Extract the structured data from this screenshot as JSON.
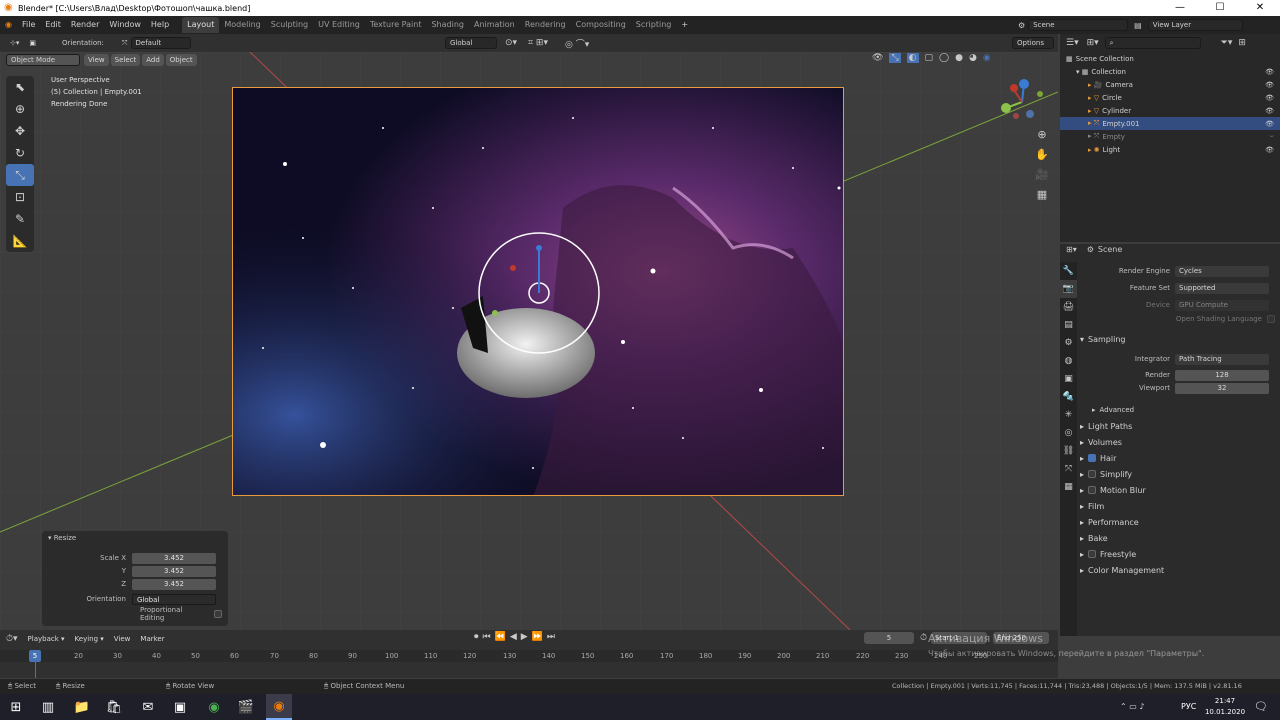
{
  "title_bar": {
    "text": "Blender* [C:\\Users\\Влад\\Desktop\\Фотошоп\\чашка.blend]"
  },
  "menu": [
    "File",
    "Edit",
    "Render",
    "Window",
    "Help"
  ],
  "workspaces": [
    "Layout",
    "Modeling",
    "Sculpting",
    "UV Editing",
    "Texture Paint",
    "Shading",
    "Animation",
    "Rendering",
    "Compositing",
    "Scripting"
  ],
  "scene": {
    "name": "Scene",
    "view_layer": "View Layer"
  },
  "header": {
    "orientation_label": "Orientation:",
    "orientation_value": "Default",
    "transform": "Global",
    "options": "Options"
  },
  "mode_bar": {
    "mode": "Object Mode",
    "view": "View",
    "select": "Select",
    "add": "Add",
    "object": "Object"
  },
  "viewport_info": {
    "line1": "User Perspective",
    "line2": "(5) Collection | Empty.001",
    "line3": "Rendering Done"
  },
  "redo_panel": {
    "title": "Resize",
    "scale_x_label": "Scale X",
    "scale_x": "3.452",
    "y_label": "Y",
    "y": "3.452",
    "z_label": "Z",
    "z": "3.452",
    "orientation_label": "Orientation",
    "orientation": "Global",
    "proportional_label": "Proportional Editing"
  },
  "outliner": {
    "root": "Scene Collection",
    "collection": "Collection",
    "items": [
      "Camera",
      "Circle",
      "Cylinder",
      "Empty.001",
      "Empty",
      "Light"
    ]
  },
  "properties": {
    "context": "Scene",
    "render_engine_label": "Render Engine",
    "render_engine": "Cycles",
    "feature_set_label": "Feature Set",
    "feature_set": "Supported",
    "device_label": "Device",
    "device": "GPU Compute",
    "osl_label": "Open Shading Language",
    "sampling": "Sampling",
    "integrator_label": "Integrator",
    "integrator": "Path Tracing",
    "render_label": "Render",
    "render_samples": "128",
    "viewport_label": "Viewport",
    "viewport_samples": "32",
    "advanced": "Advanced",
    "panels": [
      "Light Paths",
      "Volumes",
      "Hair",
      "Simplify",
      "Motion Blur",
      "Film",
      "Performance",
      "Bake",
      "Freestyle",
      "Color Management"
    ]
  },
  "timeline": {
    "menus": [
      "Playback",
      "Keying",
      "View",
      "Marker"
    ],
    "current_frame": "5",
    "start_label": "Start",
    "start": "1",
    "end_label": "End",
    "end": "250",
    "ruler": [
      "5",
      "20",
      "30",
      "40",
      "50",
      "60",
      "70",
      "80",
      "90",
      "100",
      "110",
      "120",
      "130",
      "140",
      "150",
      "160",
      "170",
      "180",
      "190",
      "200",
      "210",
      "220",
      "230",
      "240",
      "250"
    ]
  },
  "watermark": {
    "line1": "Активация Windows",
    "line2": "Чтобы активировать Windows, перейдите в раздел \"Параметры\"."
  },
  "status": {
    "select": "Select",
    "resize": "Resize",
    "rotate": "Rotate View",
    "context": "Object Context Menu",
    "stats": "Collection | Empty.001 | Verts:11,745 | Faces:11,744 | Tris:23,488 | Objects:1/5 | Mem: 137.5 MiB | v2.81.16"
  },
  "taskbar": {
    "lang": "РУС",
    "time": "21:47",
    "date": "10.01.2020"
  },
  "colors": {
    "accent": "#4772b3",
    "active_orange": "#e89a3c",
    "x_axis": "#c0392b",
    "y_axis": "#8bc34a"
  }
}
